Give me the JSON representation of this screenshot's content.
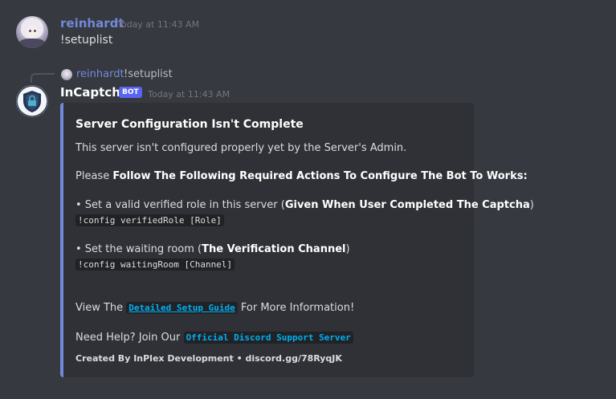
{
  "message1": {
    "username": "reinhardt",
    "timestamp": "Today at 11:43 AM",
    "content": "!setuplist",
    "username_color": "#7289da"
  },
  "reply": {
    "username": "reinhardt",
    "content": "!setuplist"
  },
  "message2": {
    "username": "InCaptcha",
    "badge": "BOT",
    "timestamp": "Today at 11:43 AM"
  },
  "embed": {
    "accent_color": "#7289da",
    "title": "Server Configuration Isn't Complete",
    "description": "This server isn't configured properly yet by the Server's Admin.",
    "please_prefix": "Please ",
    "please_bold": "Follow The Following Required Actions To Configure The Bot To Works:",
    "step1_prefix": "• Set a valid verified role in this server (",
    "step1_bold": "Given When User Completed The Captcha",
    "step1_suffix": ")",
    "step1_command": "!config verifiedRole [Role]",
    "step2_prefix": "• Set the waiting room (",
    "step2_bold": "The Verification Channel",
    "step2_suffix": ")",
    "step2_command": "!config waitingRoom [Channel]",
    "view_prefix": "View The ",
    "view_link": "Detailed Setup Guide",
    "view_suffix": " For More Information!",
    "help_prefix": "Need Help? Join Our ",
    "help_link": "Official Discord Support Server",
    "footer": "Created By InPlex Development • discord.gg/78RyqJK"
  }
}
